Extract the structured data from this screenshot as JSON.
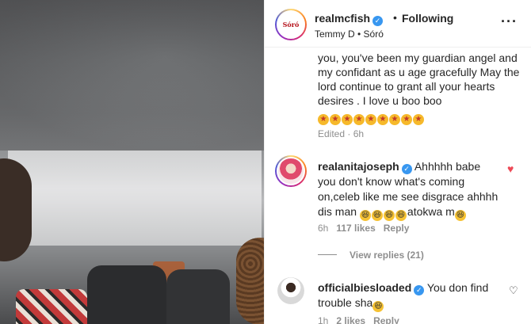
{
  "post": {
    "username": "realmcfish",
    "separator": "•",
    "follow_state": "Following",
    "subtitle": "Temmy D • Sóró",
    "avatar_text": "Sóró",
    "more_icon": "more-horizontal-icon"
  },
  "caption": {
    "text": "you, you've been my guardian angel and my confidant as u age gracefully May the lord continue to grant all your hearts desires . I love u boo boo",
    "emoji_count": 9,
    "meta": "Edited · 6h"
  },
  "comments": [
    {
      "username": "realanitajoseph",
      "text": "Ahhhhh babe you don't know what's coming on,celeb like me see disgrace ahhhh dis man",
      "text_tail": "atokwa m",
      "time": "6h",
      "likes": "117 likes",
      "reply": "Reply",
      "liked": true,
      "view_replies": "View replies (21)"
    },
    {
      "username": "officialbiesloaded",
      "text": "You don find trouble sha",
      "time": "1h",
      "likes": "2 likes",
      "reply": "Reply",
      "liked": false
    }
  ],
  "colors": {
    "verified": "#3897f0",
    "heart": "#ed4956",
    "meta": "#8e8e8e"
  }
}
